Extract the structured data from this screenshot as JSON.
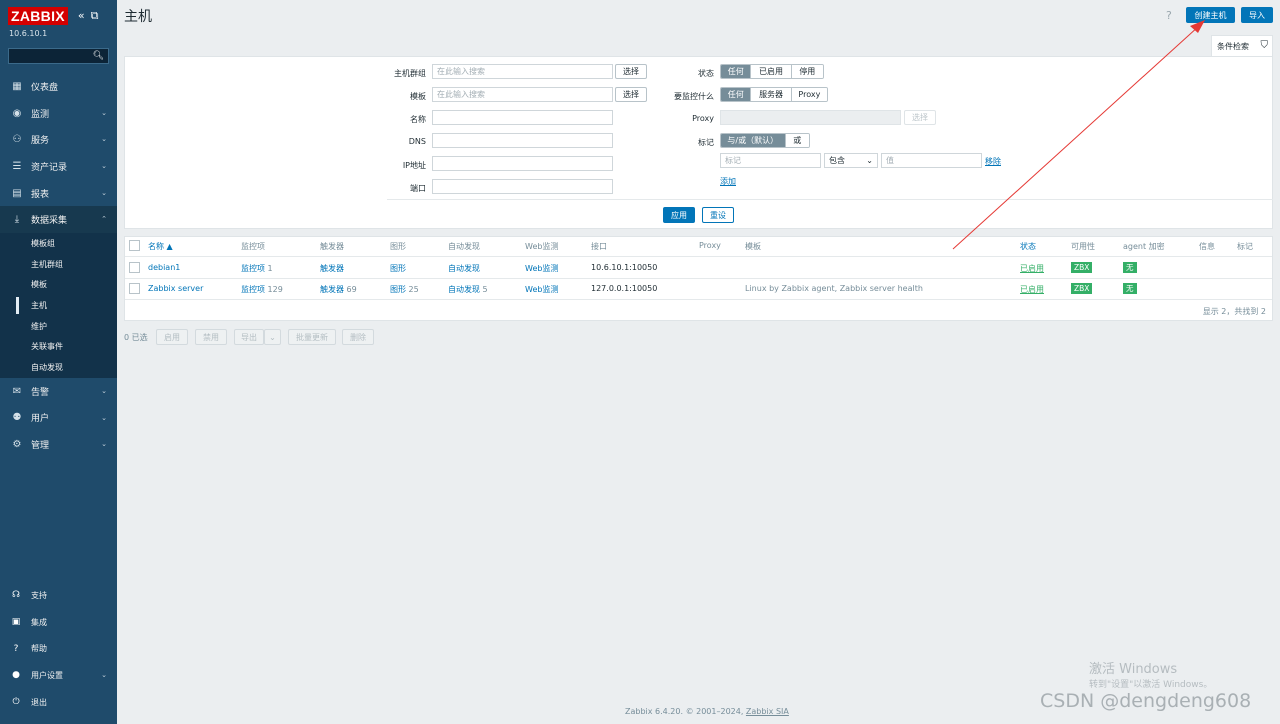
{
  "sidebar": {
    "logo": "ZABBIX",
    "version": "10.6.10.1",
    "search_placeholder": "",
    "items": [
      {
        "label": "仪表盘",
        "icon": "dashboard-icon"
      },
      {
        "label": "监测",
        "icon": "eye-icon"
      },
      {
        "label": "服务",
        "icon": "services-icon"
      },
      {
        "label": "资产记录",
        "icon": "list-icon"
      },
      {
        "label": "报表",
        "icon": "report-icon"
      },
      {
        "label": "数据采集",
        "icon": "download-icon"
      }
    ],
    "submenu": [
      "模板组",
      "主机群组",
      "模板",
      "主机",
      "维护",
      "关联事件",
      "自动发现"
    ],
    "items2": [
      {
        "label": "告警",
        "icon": "mail-icon"
      },
      {
        "label": "用户",
        "icon": "users-icon"
      },
      {
        "label": "管理",
        "icon": "gear-icon"
      }
    ],
    "bottom": [
      {
        "label": "支持",
        "icon": "headset-icon"
      },
      {
        "label": "集成",
        "icon": "integration-icon"
      },
      {
        "label": "帮助",
        "icon": "help-icon"
      },
      {
        "label": "用户设置",
        "icon": "user-icon"
      },
      {
        "label": "退出",
        "icon": "power-icon"
      }
    ]
  },
  "header": {
    "title": "主机",
    "help": "?",
    "create_host": "创建主机",
    "import": "导入"
  },
  "filter": {
    "tab_label": "条件检索",
    "host_groups_label": "主机群组",
    "host_groups_placeholder": "在此输入搜索",
    "templates_label": "模板",
    "templates_placeholder": "在此输入搜索",
    "select": "选择",
    "name_label": "名称",
    "dns_label": "DNS",
    "ip_label": "IP地址",
    "port_label": "端口",
    "status_label": "状态",
    "status_options": [
      "任何",
      "已启用",
      "停用"
    ],
    "monitored_by_label": "要监控什么",
    "monitored_by_options": [
      "任何",
      "服务器",
      "Proxy"
    ],
    "proxy_label": "Proxy",
    "tags_label": "标记",
    "tags_options": [
      "与/或（默认）",
      "或"
    ],
    "tag_placeholder": "标记",
    "operator": "包含",
    "value_placeholder": "值",
    "remove": "移除",
    "add": "添加",
    "apply": "应用",
    "reset": "重设"
  },
  "table": {
    "headers": {
      "name": "名称 ▲",
      "items": "监控项",
      "triggers": "触发器",
      "graphs": "图形",
      "discovery": "自动发现",
      "web": "Web监测",
      "interface": "接口",
      "proxy": "Proxy",
      "templates": "模板",
      "status": "状态",
      "availability": "可用性",
      "agent_encryption": "agent 加密",
      "info": "信息",
      "tags": "标记"
    },
    "rows": [
      {
        "name": "debian1",
        "items": "监控项",
        "items_count": "1",
        "triggers": "触发器",
        "triggers_count": "",
        "graphs": "图形",
        "graphs_count": "",
        "discovery": "自动发现",
        "discovery_count": "",
        "web": "Web监测",
        "interface": "10.6.10.1:10050",
        "templates": "",
        "status": "已启用",
        "availability": "ZBX",
        "encryption": "无"
      },
      {
        "name": "Zabbix server",
        "items": "监控项",
        "items_count": "129",
        "triggers": "触发器",
        "triggers_count": "69",
        "graphs": "图形",
        "graphs_count": "25",
        "discovery": "自动发现",
        "discovery_count": "5",
        "web": "Web监测",
        "interface": "127.0.0.1:10050",
        "templates": "Linux by Zabbix agent, Zabbix server health",
        "status": "已启用",
        "availability": "ZBX",
        "encryption": "无"
      }
    ],
    "summary": "显示 2，共找到 2"
  },
  "mass_actions": {
    "selected": "0 已选",
    "enable": "启用",
    "disable": "禁用",
    "export": "导出",
    "mass_update": "批量更新",
    "delete": "删除"
  },
  "footer": {
    "text": "Zabbix 6.4.20. © 2001–2024,",
    "link": "Zabbix SIA"
  },
  "watermark": {
    "line1": "激活 Windows",
    "line2": "转到\"设置\"以激活 Windows。",
    "csdn": "CSDN @dengdeng608"
  },
  "colors": {
    "sidebar": "#1f4b6b",
    "primary": "#0275b8",
    "green": "#34af67",
    "annotation": "#e53935"
  }
}
